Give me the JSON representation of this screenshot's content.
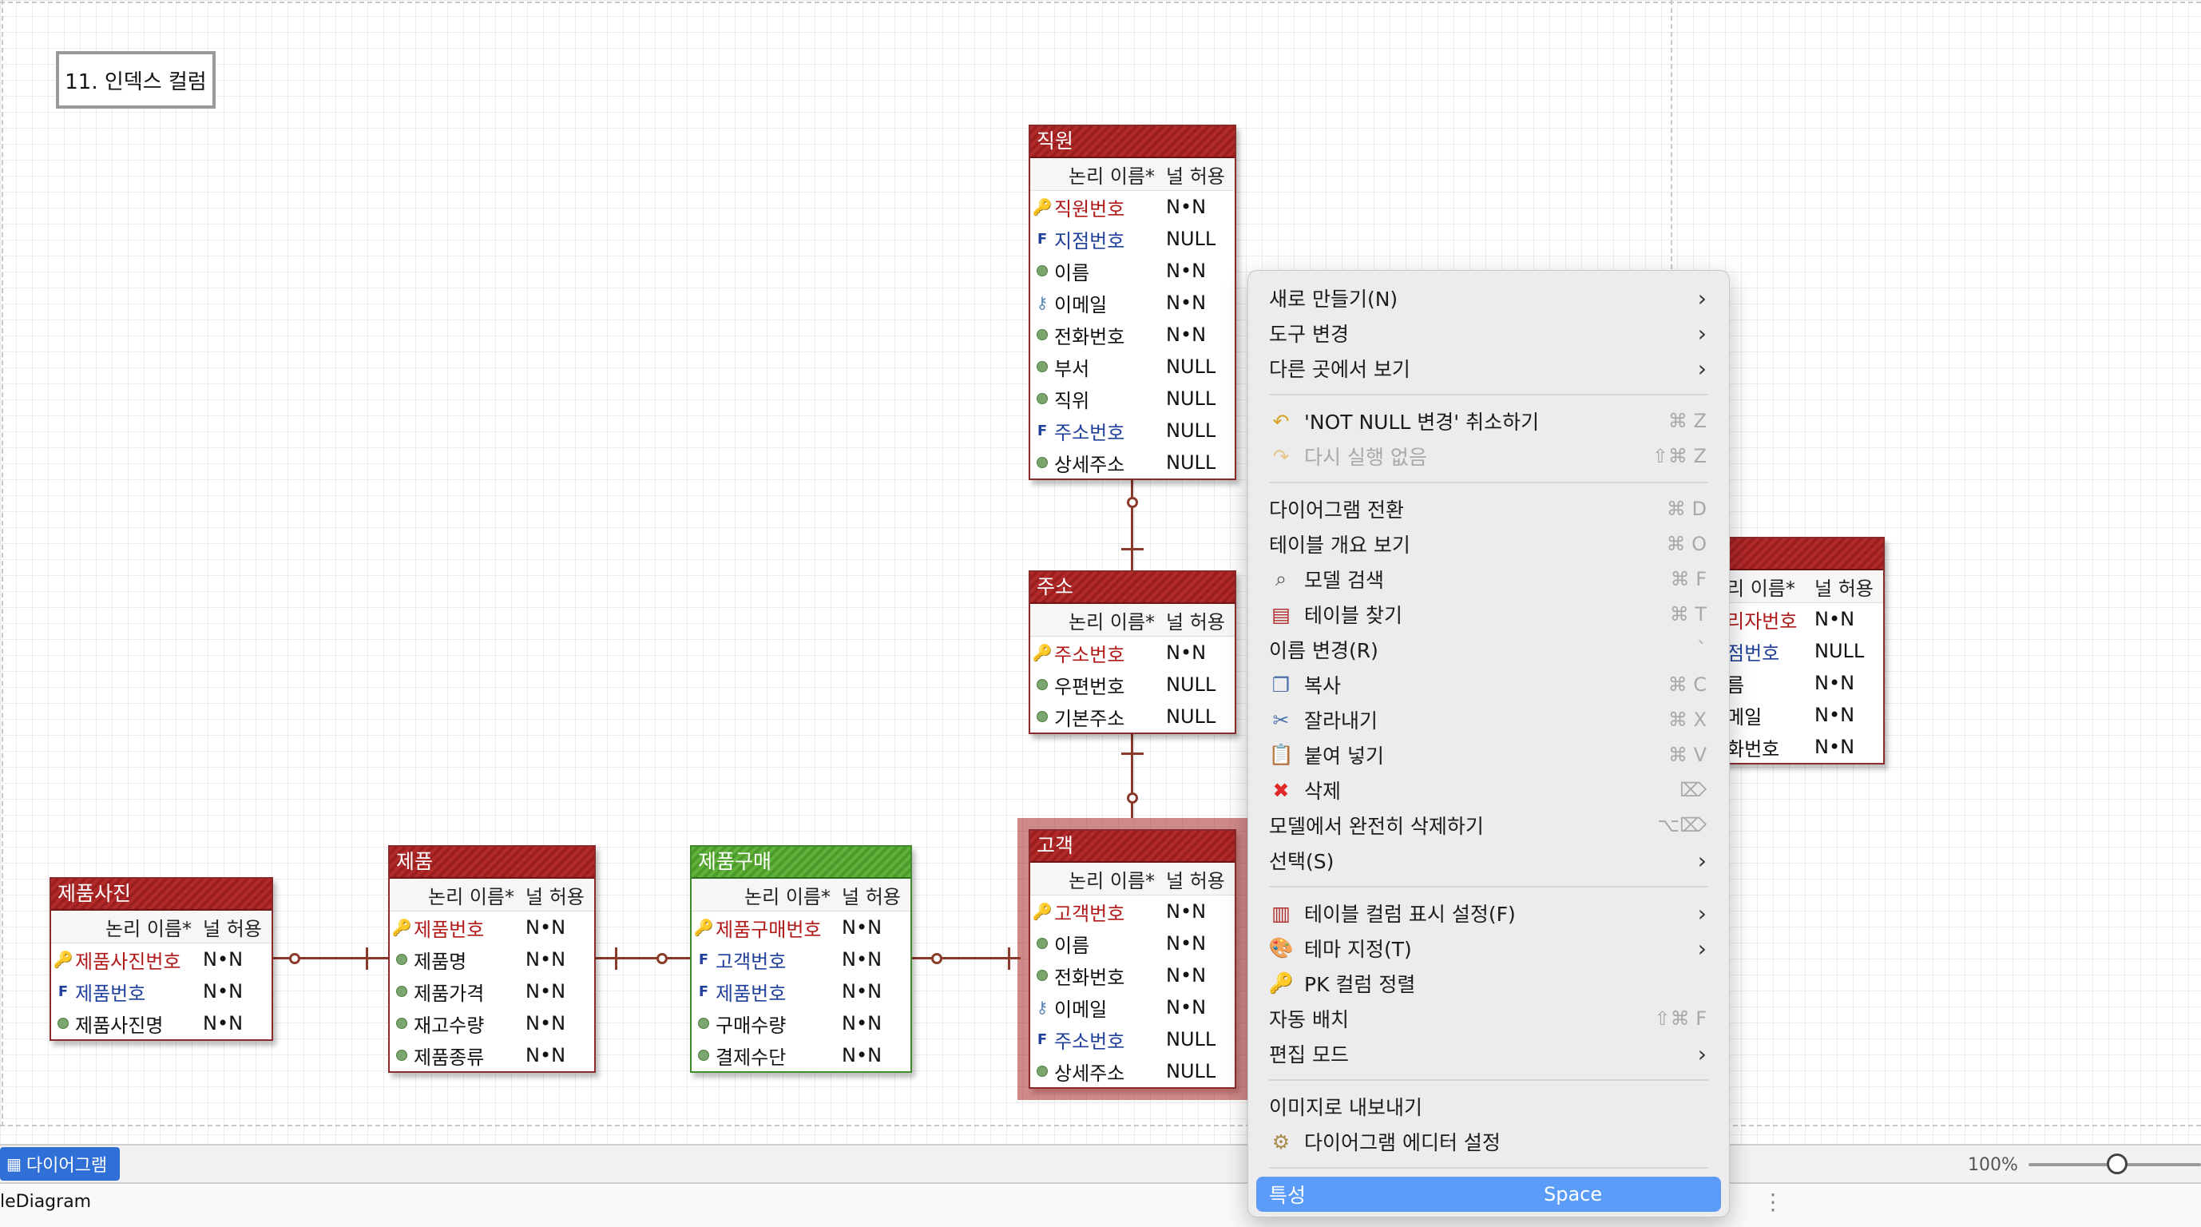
{
  "note": {
    "text": "11. 인덱스 컬럼"
  },
  "header_labels": {
    "logical": "논리 이름*",
    "nullable": "널 허용"
  },
  "tables": {
    "employee": {
      "title": "직원",
      "rows": [
        {
          "name": "직원번호",
          "null": "N•N"
        },
        {
          "name": "지점번호",
          "null": "NULL"
        },
        {
          "name": "이름",
          "null": "N•N"
        },
        {
          "name": "이메일",
          "null": "N•N"
        },
        {
          "name": "전화번호",
          "null": "N•N"
        },
        {
          "name": "부서",
          "null": "NULL"
        },
        {
          "name": "직위",
          "null": "NULL"
        },
        {
          "name": "주소번호",
          "null": "NULL"
        },
        {
          "name": "상세주소",
          "null": "NULL"
        }
      ]
    },
    "address": {
      "title": "주소",
      "rows": [
        {
          "name": "주소번호",
          "null": "N•N"
        },
        {
          "name": "우편번호",
          "null": "NULL"
        },
        {
          "name": "기본주소",
          "null": "NULL"
        }
      ]
    },
    "customer": {
      "title": "고객",
      "rows": [
        {
          "name": "고객번호",
          "null": "N•N"
        },
        {
          "name": "이름",
          "null": "N•N"
        },
        {
          "name": "전화번호",
          "null": "N•N"
        },
        {
          "name": "이메일",
          "null": "N•N"
        },
        {
          "name": "주소번호",
          "null": "NULL"
        },
        {
          "name": "상세주소",
          "null": "NULL"
        }
      ]
    },
    "product_photo": {
      "title": "제품사진",
      "rows": [
        {
          "name": "제품사진번호",
          "null": "N•N"
        },
        {
          "name": "제품번호",
          "null": "N•N"
        },
        {
          "name": "제품사진명",
          "null": "N•N"
        }
      ]
    },
    "product": {
      "title": "제품",
      "rows": [
        {
          "name": "제품번호",
          "null": "N•N"
        },
        {
          "name": "제품명",
          "null": "N•N"
        },
        {
          "name": "제품가격",
          "null": "N•N"
        },
        {
          "name": "재고수량",
          "null": "N•N"
        },
        {
          "name": "제품종류",
          "null": "N•N"
        }
      ]
    },
    "purchase": {
      "title": "제품구매",
      "rows": [
        {
          "name": "제품구매번호",
          "null": "N•N"
        },
        {
          "name": "고객번호",
          "null": "N•N"
        },
        {
          "name": "제품번호",
          "null": "N•N"
        },
        {
          "name": "구매수량",
          "null": "N•N"
        },
        {
          "name": "결제수단",
          "null": "N•N"
        }
      ]
    },
    "partial": {
      "header_logical": "리 이름*",
      "header_nullable": "널 허용",
      "rows": [
        {
          "name": "리자번호",
          "null": "N•N"
        },
        {
          "name": "점번호",
          "null": "NULL"
        },
        {
          "name": "름",
          "null": "N•N"
        },
        {
          "name": "메일",
          "null": "N•N"
        },
        {
          "name": "화번호",
          "null": "N•N"
        }
      ]
    }
  },
  "menu": {
    "new": "새로 만들기(N)",
    "change_tool": "도구 변경",
    "view_elsewhere": "다른 곳에서 보기",
    "undo": "'NOT NULL 변경' 취소하기",
    "undo_shortcut": "⌘ Z",
    "redo": "다시 실행 없음",
    "redo_shortcut": "⇧⌘ Z",
    "switch_diagram": "다이어그램 전환",
    "switch_diagram_shortcut": "⌘ D",
    "table_outline": "테이블 개요 보기",
    "table_outline_shortcut": "⌘ O",
    "model_search": "모델 검색",
    "model_search_shortcut": "⌘ F",
    "find_table": "테이블 찾기",
    "find_table_shortcut": "⌘ T",
    "rename": "이름 변경(R)",
    "rename_shortcut": "`",
    "copy": "복사",
    "copy_shortcut": "⌘ C",
    "cut": "잘라내기",
    "cut_shortcut": "⌘ X",
    "paste": "붙여 넣기",
    "paste_shortcut": "⌘ V",
    "delete": "삭제",
    "delete_shortcut": "⌦",
    "delete_model": "모델에서 완전히 삭제하기",
    "delete_model_shortcut": "⌥⌦",
    "select": "선택(S)",
    "column_display": "테이블 컬럼 표시 설정(F)",
    "theme": "테마 지정(T)",
    "pk_sort": "PK 컬럼 정렬",
    "auto_layout": "자동 배치",
    "auto_layout_shortcut": "⇧⌘ F",
    "edit_mode": "편집 모드",
    "export_image": "이미지로 내보내기",
    "editor_settings": "다이어그램 에디터 설정",
    "properties": "특성",
    "properties_shortcut": "Space"
  },
  "tabbar": {
    "tab_label": "다이어그램",
    "zoom": "100%",
    "zoom_level_percent": 100
  },
  "status": {
    "label": "leDiagram"
  },
  "colors": {
    "table_header": "#b22a2a",
    "table_header_green": "#5fb23a",
    "menu_highlight": "#5a9cf8",
    "pk_text": "#b01818",
    "fk_text": "#1f3f9a"
  }
}
